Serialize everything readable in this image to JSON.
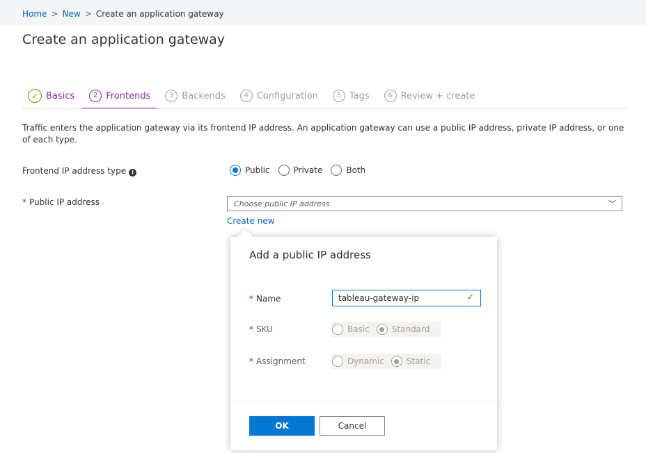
{
  "breadcrumb": {
    "home": "Home",
    "new": "New",
    "current": "Create an application gateway",
    "sep": ">"
  },
  "page_title": "Create an application gateway",
  "tabs": [
    {
      "num": "✓",
      "label": "Basics"
    },
    {
      "num": "2",
      "label": "Frontends"
    },
    {
      "num": "3",
      "label": "Backends"
    },
    {
      "num": "4",
      "label": "Configuration"
    },
    {
      "num": "5",
      "label": "Tags"
    },
    {
      "num": "6",
      "label": "Review + create"
    }
  ],
  "description": "Traffic enters the application gateway via its frontend IP address. An application gateway can use a public IP address, private IP address, or one of each type.",
  "frontend_type": {
    "label": "Frontend IP address type",
    "info_icon": "i",
    "options": [
      "Public",
      "Private",
      "Both"
    ],
    "selected": "Public"
  },
  "public_ip": {
    "required_mark": "*",
    "label": "Public IP address",
    "placeholder": "Choose public IP address",
    "chevron": "﹀",
    "create_new": "Create new"
  },
  "flyout": {
    "title": "Add a public IP address",
    "name_label": "Name",
    "name_value": "tableau-gateway-ip",
    "sku_label": "SKU",
    "sku_options": [
      "Basic",
      "Standard"
    ],
    "sku_selected": "Standard",
    "assignment_label": "Assignment",
    "assignment_options": [
      "Dynamic",
      "Static"
    ],
    "assignment_selected": "Static",
    "ok": "OK",
    "cancel": "Cancel"
  },
  "colors": {
    "accent": "#0078d4",
    "tab_active": "#8a2da5",
    "success": "#57a300",
    "required": "#a4262c"
  }
}
